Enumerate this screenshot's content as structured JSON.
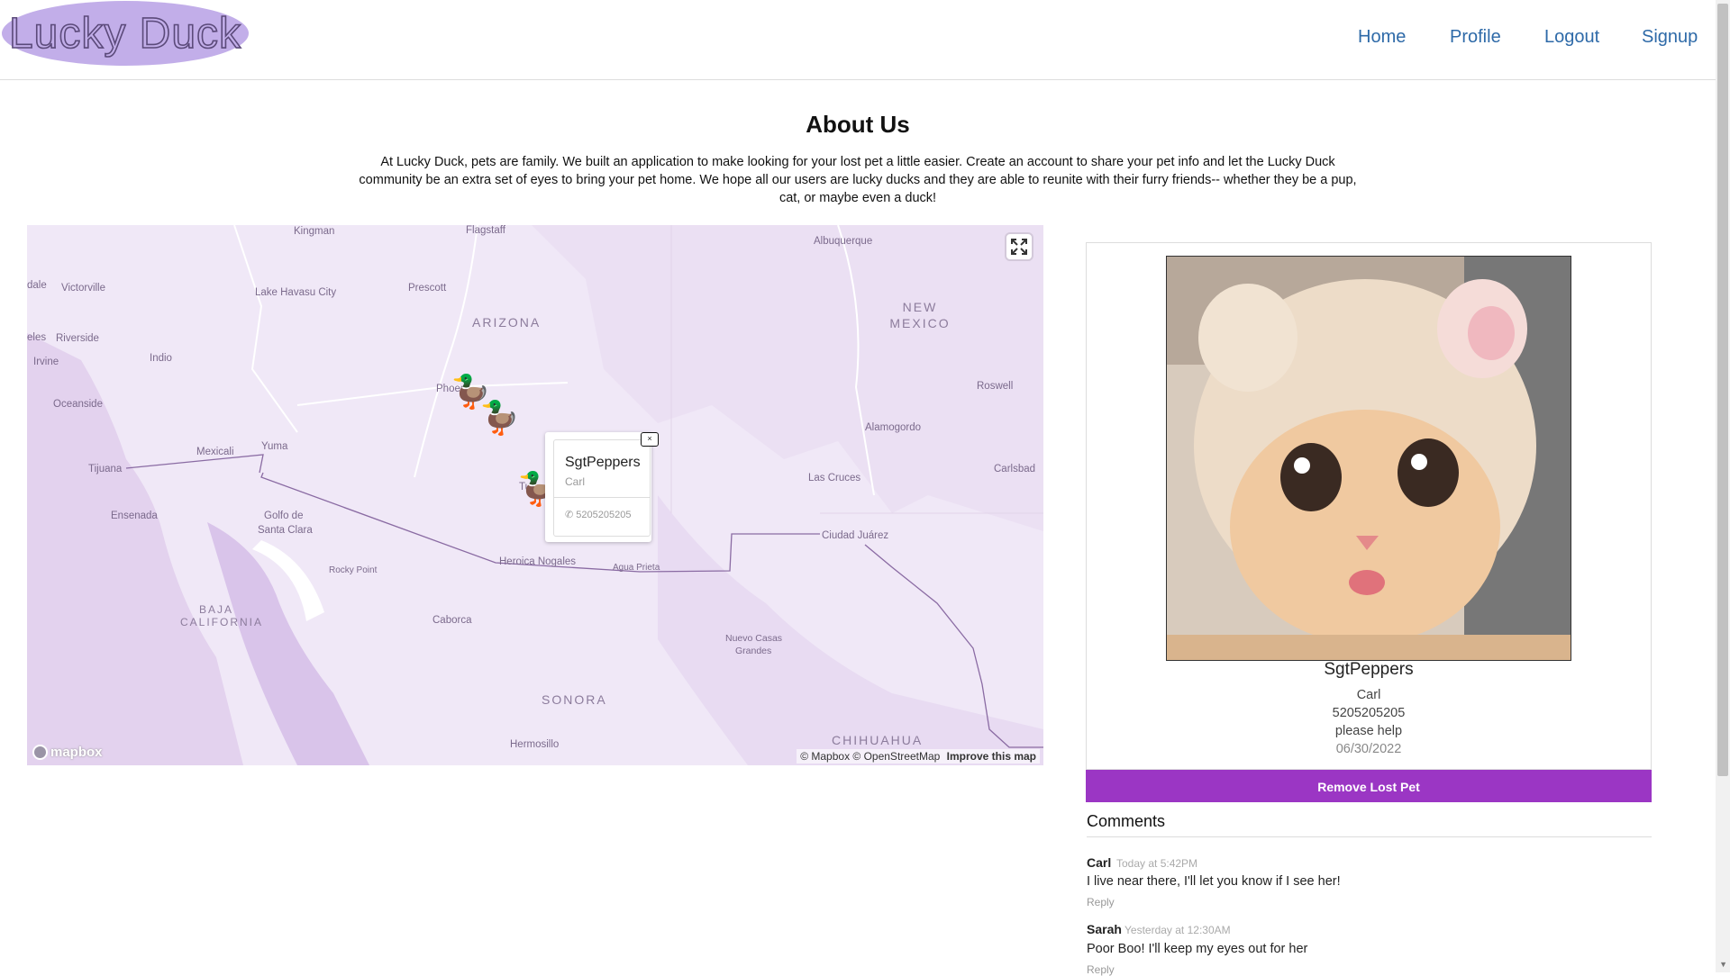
{
  "header": {
    "logo": "Lucky Duck",
    "nav": [
      "Home",
      "Profile",
      "Logout",
      "Signup"
    ]
  },
  "about": {
    "title": "About Us",
    "text": "At Lucky Duck, pets are family. We built an application to make looking for your lost pet a little easier. Create an account to share your pet info and let the Lucky Duck community be an extra set of eyes to bring your pet home. We hope all our users are lucky ducks and they are able to reunite with their furry friends-- whether they be a pup, cat, or maybe even a duck!"
  },
  "map": {
    "labels": {
      "kingman": "Kingman",
      "flagstaff": "Flagstaff",
      "albuquerque": "Albuquerque",
      "dale": "dale",
      "victorville": "Victorville",
      "lake_havasu": "Lake Havasu City",
      "prescott": "Prescott",
      "arizona": "ARIZONA",
      "new_mexico_1": "NEW",
      "new_mexico_2": "MEXICO",
      "eles": "eles",
      "riverside": "Riverside",
      "irvine": "Irvine",
      "indio": "Indio",
      "phoenix": "Phoen",
      "roswell": "Roswell",
      "oceanside": "Oceanside",
      "alamogordo": "Alamogordo",
      "yuma": "Yuma",
      "mexicali": "Mexicali",
      "tijuana": "Tijuana",
      "tucson": "Tuc",
      "las_cruces": "Las Cruces",
      "carlsbad": "Carlsbad",
      "ensenada": "Ensenada",
      "golfo_1": "Golfo de",
      "golfo_2": "Santa Clara",
      "ciudad_juarez": "Ciudad Juárez",
      "heroica_nogales": "Heroica Nogales",
      "agua_prieta": "Agua Prieta",
      "rocky_point": "Rocky Point",
      "baja_1": "BAJA",
      "baja_2": "CALIFORNIA",
      "caborca": "Caborca",
      "nuevo_casas_1": "Nuevo Casas",
      "nuevo_casas_2": "Grandes",
      "sonora": "SONORA",
      "chihuahua": "CHIHUAHUA",
      "hermosillo": "Hermosillo"
    },
    "mapbox_logo": "mapbox",
    "attribution": "© Mapbox © OpenStreetMap",
    "improve": "Improve this map",
    "popup": {
      "close": "×",
      "name": "SgtPeppers",
      "owner": "Carl",
      "phone_icon": "phone-icon",
      "phone": "5205205205"
    }
  },
  "pet": {
    "name": "SgtPeppers",
    "owner": "Carl",
    "phone": "5205205205",
    "description": "please help",
    "date": "06/30/2022",
    "remove_label": "Remove Lost Pet"
  },
  "comments": {
    "title": "Comments",
    "items": [
      {
        "author": "Carl",
        "time": "Today at 5:42PM",
        "text": "I live near there, I'll let you know if I see her!",
        "reply": "Reply"
      },
      {
        "author": "Sarah",
        "time": "Yesterday at 12:30AM",
        "text": "Poor Boo! I'll keep my eyes out for her",
        "reply": "Reply"
      }
    ]
  },
  "colors": {
    "accent": "#9b36c4",
    "logo_bg": "#c2aee9",
    "link": "#2e6aa8",
    "map_bg": "#f0e8f7"
  }
}
